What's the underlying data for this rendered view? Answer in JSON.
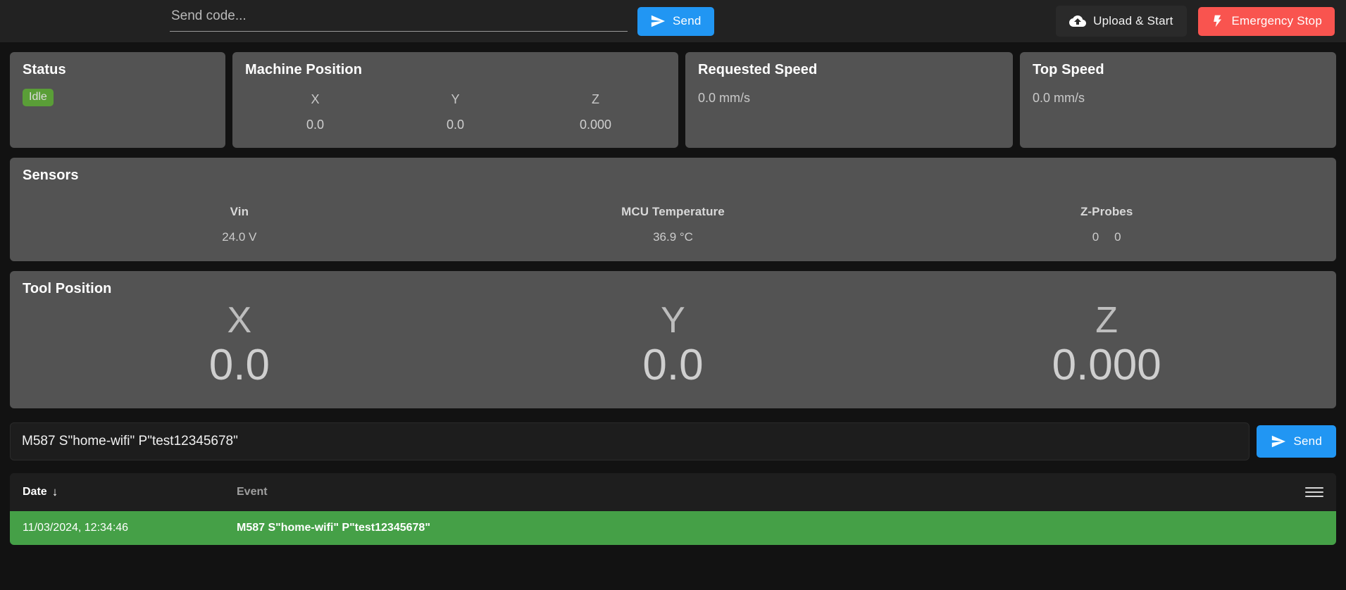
{
  "topbar": {
    "code_input_placeholder": "Send code...",
    "code_input_value": "",
    "send_label": "Send",
    "upload_label": "Upload & Start",
    "estop_label": "Emergency Stop",
    "send_icon": "paper-plane-icon",
    "upload_icon": "cloud-upload-icon",
    "estop_icon": "lightning-bolt-icon",
    "accent_blue": "#2196f3",
    "danger_red": "#f9544f"
  },
  "status_card": {
    "title": "Status",
    "badge": "Idle",
    "badge_color": "#5a9e37"
  },
  "machine_position": {
    "title": "Machine Position",
    "axes": [
      {
        "label": "X",
        "value": "0.0"
      },
      {
        "label": "Y",
        "value": "0.0"
      },
      {
        "label": "Z",
        "value": "0.000"
      }
    ]
  },
  "requested_speed": {
    "title": "Requested Speed",
    "value": "0.0 mm/s"
  },
  "top_speed": {
    "title": "Top Speed",
    "value": "0.0 mm/s"
  },
  "sensors": {
    "title": "Sensors",
    "items": [
      {
        "label": "Vin",
        "value": "24.0 V"
      },
      {
        "label": "MCU Temperature",
        "value": "36.9 °C"
      },
      {
        "label": "Z-Probes",
        "value": "0",
        "value2": "0"
      }
    ]
  },
  "tool_position": {
    "title": "Tool Position",
    "axes": [
      {
        "label": "X",
        "value": "0.0"
      },
      {
        "label": "Y",
        "value": "0.0"
      },
      {
        "label": "Z",
        "value": "0.000"
      }
    ]
  },
  "command_bar": {
    "input_value": "M587 S\"home-wifi\" P\"test12345678\"",
    "input_placeholder": "Send code...",
    "send_label": "Send",
    "send_icon": "paper-plane-icon"
  },
  "console_table": {
    "columns": {
      "date": "Date",
      "event": "Event"
    },
    "sort_indicator": "↓",
    "menu_icon": "hamburger-menu-icon",
    "rows": [
      {
        "date": "11/03/2024, 12:34:46",
        "event": "M587 S\"home-wifi\" P\"test12345678\"",
        "row_color": "#45a047"
      }
    ]
  }
}
